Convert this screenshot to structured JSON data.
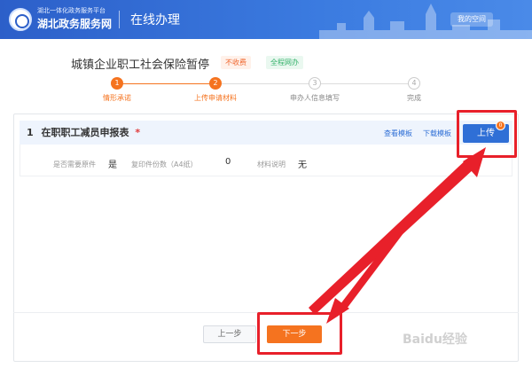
{
  "header": {
    "logo_sub": "湖北一体化政务服务平台",
    "logo_main": "湖北政务服务网",
    "title": "在线办理",
    "user_label": "我的空间"
  },
  "service": {
    "title": "城镇企业职工社会保险暂停",
    "badge_fee": "不收费",
    "badge_online": "全程网办"
  },
  "steps": [
    {
      "num": "1",
      "label": "情形承诺",
      "active": true
    },
    {
      "num": "2",
      "label": "上传申请材料",
      "active": true
    },
    {
      "num": "3",
      "label": "申办人信息填写",
      "active": false
    },
    {
      "num": "4",
      "label": "完成",
      "active": false
    }
  ],
  "material": {
    "index": "1",
    "name": "在职职工减员申报表",
    "required_mark": "*",
    "view_sample": "查看模板",
    "download_template": "下载模板",
    "upload_label": "上传",
    "upload_count": "0",
    "info": [
      {
        "label": "是否需要原件",
        "value": "是"
      },
      {
        "label": "复印件份数（A4纸）",
        "value": "0"
      },
      {
        "label": "材料说明",
        "value": "无"
      }
    ]
  },
  "footer": {
    "prev_label": "上一步",
    "next_label": "下一步"
  },
  "watermark": "Baidu经验",
  "colors": {
    "header_blue": "#2c5fc9",
    "accent_orange": "#f5731f",
    "link_blue": "#2f6fd6",
    "highlight_red": "#e8202a"
  }
}
